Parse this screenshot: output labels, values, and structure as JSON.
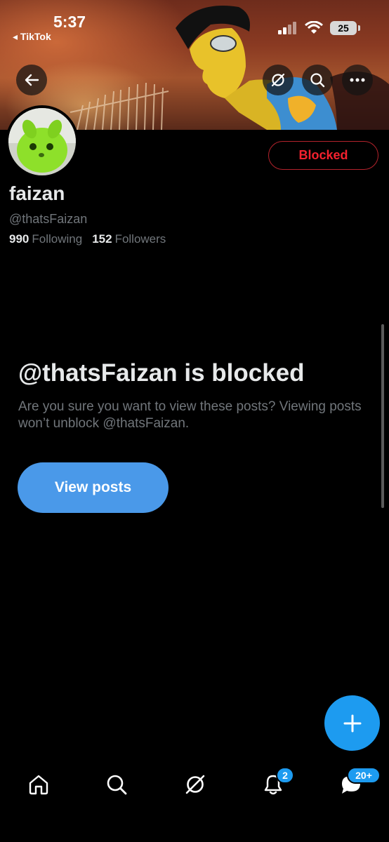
{
  "status_bar": {
    "time": "5:37",
    "back_app": "◂ TikTok",
    "battery": "25"
  },
  "profile": {
    "name": "faizan",
    "handle": "@thatsFaizan",
    "following_count": "990",
    "following_label": "Following",
    "followers_count": "152",
    "followers_label": "Followers",
    "blocked_button": "Blocked"
  },
  "blocked_notice": {
    "title": "@thatsFaizan is blocked",
    "description": "Are you sure you want to view these posts? Viewing posts won’t unblock @thatsFaizan.",
    "view_posts_button": "View posts"
  },
  "nav": {
    "notifications_badge": "2",
    "messages_badge": "20+"
  },
  "icons": [
    "back-arrow-icon",
    "grok-icon",
    "search-icon",
    "more-icon",
    "plus-icon",
    "home-icon",
    "explore-icon",
    "notifications-icon",
    "messages-icon"
  ],
  "colors": {
    "accent": "#1d9bf0",
    "view_button": "#4a99e9",
    "blocked_red": "#f4212e",
    "secondary_text": "#71767b"
  }
}
